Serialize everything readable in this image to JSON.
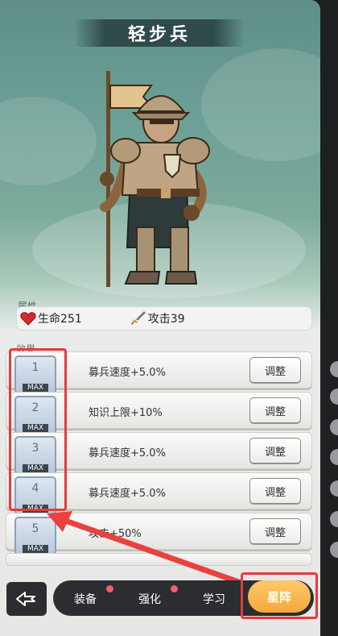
{
  "header": {
    "title": "轻步兵"
  },
  "stats": {
    "section_label": "属性",
    "hp_label": "生命251",
    "attack_label": "攻击39"
  },
  "effects": {
    "section_label": "效果",
    "adjust_label": "调整",
    "max_label": "MAX",
    "items": [
      {
        "num": "1",
        "text": "募兵速度+5.0%"
      },
      {
        "num": "2",
        "text": "知识上限+10%"
      },
      {
        "num": "3",
        "text": "募兵速度+5.0%"
      },
      {
        "num": "4",
        "text": "募兵速度+5.0%"
      },
      {
        "num": "5",
        "text": "攻击+50%"
      }
    ]
  },
  "tabs": {
    "equip": "装备",
    "enhance": "强化",
    "learn": "学习",
    "star": "星阵"
  },
  "colors": {
    "accent": "#f4a93c",
    "highlight": "#e23c3c",
    "notification_dot": "#f25e6a"
  }
}
